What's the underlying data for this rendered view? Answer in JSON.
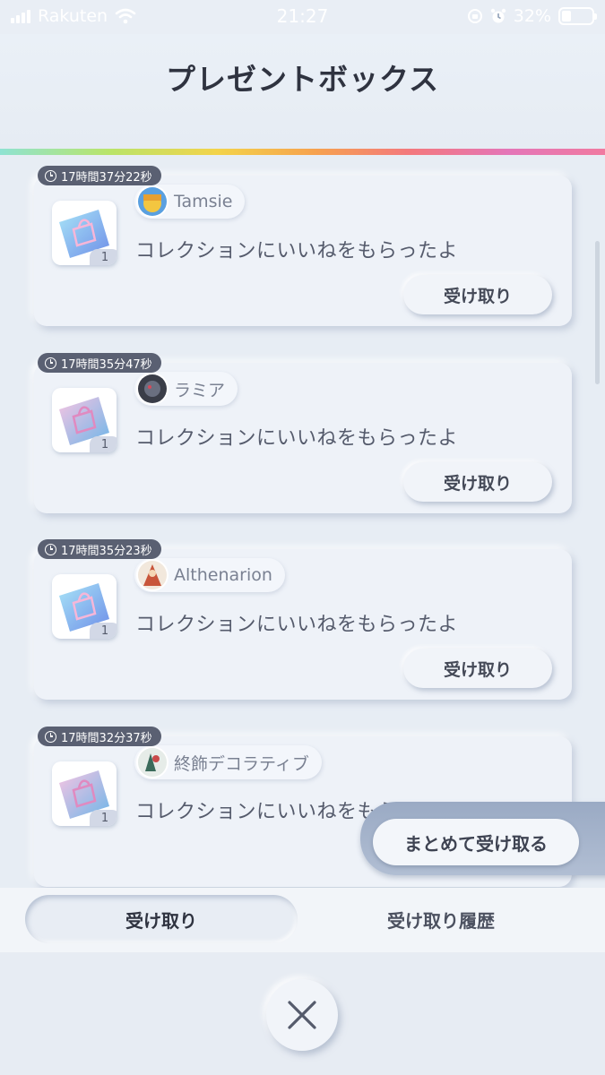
{
  "status_bar": {
    "carrier": "Rakuten",
    "time": "21:27",
    "battery_percent": "32%",
    "battery_level": 0.32
  },
  "header": {
    "title": "プレゼントボックス"
  },
  "presents": [
    {
      "timer": "17時間37分22秒",
      "sender": "Tamsie",
      "message": "コレクションにいいねをもらったよ",
      "quantity": "1",
      "button_label": "受け取り"
    },
    {
      "timer": "17時間35分47秒",
      "sender": "ラミア",
      "message": "コレクションにいいねをもらったよ",
      "quantity": "1",
      "button_label": "受け取り"
    },
    {
      "timer": "17時間35分23秒",
      "sender": "Althenarion",
      "message": "コレクションにいいねをもらったよ",
      "quantity": "1",
      "button_label": "受け取り"
    },
    {
      "timer": "17時間32分37秒",
      "sender": "終飾デコラティブ",
      "message": "コレクションにいいねをもらったよ",
      "quantity": "1",
      "button_label": "受け取り"
    }
  ],
  "receive_all": {
    "label": "まとめて受け取る"
  },
  "tabs": [
    {
      "label": "受け取り",
      "active": true
    },
    {
      "label": "受け取り履歴",
      "active": false
    }
  ],
  "icons": {
    "close": "close-icon",
    "clock": "clock-icon",
    "gift_item": "shopping-bag-icon"
  },
  "colors": {
    "accent_dark": "#5a6072",
    "background": "#e9eef5"
  }
}
